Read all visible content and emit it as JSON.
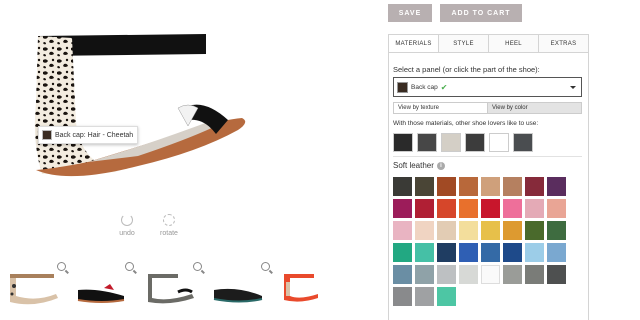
{
  "header": {
    "save_label": "SAVE",
    "cart_label": "ADD TO CART"
  },
  "tabs": [
    "MATERIALS",
    "STYLE",
    "HEEL",
    "EXTRAS"
  ],
  "select_panel_label": "Select a panel (or click the part of the shoe):",
  "selected_panel": "Back cap",
  "view_options": {
    "texture": "View by texture",
    "color": "View by color"
  },
  "recommend_label": "With those materials, other shoe lovers like to use:",
  "recommended_swatches": [
    "#2a2a2a",
    "#474747",
    "#d4cfc6",
    "#3c3c3c",
    "#ffffff",
    "#4a4d50"
  ],
  "section_title": "Soft leather",
  "info_icon": "info-icon",
  "swatches": [
    [
      "#3a3a36",
      "#4a4536",
      "#a14a24",
      "#b8683a",
      "#cfa07b",
      "#b58060",
      "#862a3a",
      "#5a2d5e"
    ],
    [
      "#9c1c5a",
      "#b01f34",
      "#d6462a",
      "#e8702c",
      "#c8162c",
      "#ee6f9a",
      "#e4aab6",
      "#e9a595"
    ],
    [
      "#e9b4c2",
      "#f0d4c2",
      "#e2ccb4",
      "#f3de9c",
      "#e7c04a",
      "#dd9a30",
      "#4a6a2c",
      "#3e6c40"
    ],
    [
      "#22a882",
      "#45c0a6",
      "#1f3d62",
      "#2f5fb4",
      "#346aa6",
      "#1e4a8a",
      "#9ccde8",
      "#7aa8d0"
    ],
    [
      "#6a8ea4",
      "#8fa2a8",
      "#bdc0c2",
      "#d7d9d6",
      "#fafafa",
      "#9a9c98",
      "#7a7c78",
      "#4e5050"
    ],
    [
      "#898a8c",
      "#9fa1a3",
      "#4dc6a4"
    ]
  ],
  "tooltip_text": "Back cap: Hair - Cheetah",
  "tools": {
    "undo": "undo",
    "rotate": "rotate"
  }
}
